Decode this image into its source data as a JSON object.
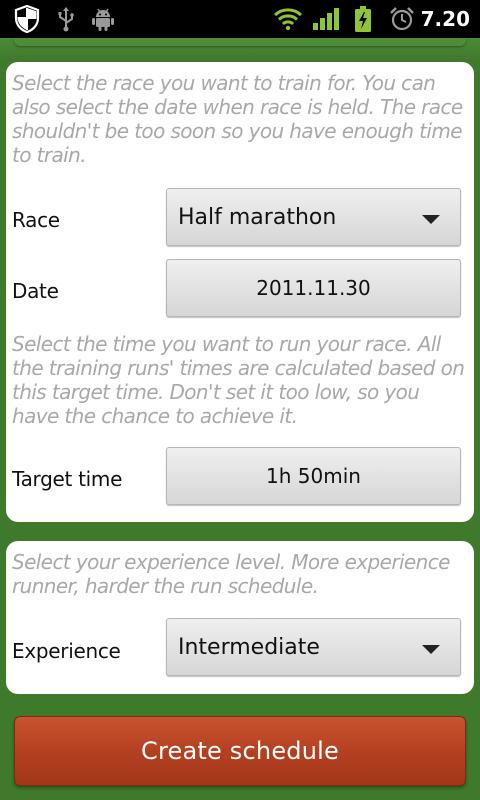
{
  "status_bar": {
    "time": "7.20",
    "icons": [
      "shield-icon",
      "usb-icon",
      "android-debug-icon",
      "wifi-icon",
      "signal-icon",
      "battery-charging-icon",
      "alarm-icon"
    ]
  },
  "race_section": {
    "hint": "Select the race you want to train for. You can also select the date when race is held. The race shouldn't be too soon so you have enough time to train.",
    "race_label": "Race",
    "race_value": "Half marathon",
    "date_label": "Date",
    "date_value": "2011.11.30",
    "time_hint": "Select the time you want to run your race. All the training runs' times are calculated based on this target time. Don't set it too low, so you have the chance to achieve it.",
    "target_label": "Target time",
    "target_value": "1h 50min"
  },
  "experience_section": {
    "hint": "Select your experience level. More experience runner, harder the run schedule.",
    "label": "Experience",
    "value": "Intermediate"
  },
  "create_button": {
    "label": "Create schedule"
  },
  "colors": {
    "background_green": "#3f7a2c",
    "button_orange": "#b23f20",
    "hint_gray": "#a8a8a8"
  }
}
